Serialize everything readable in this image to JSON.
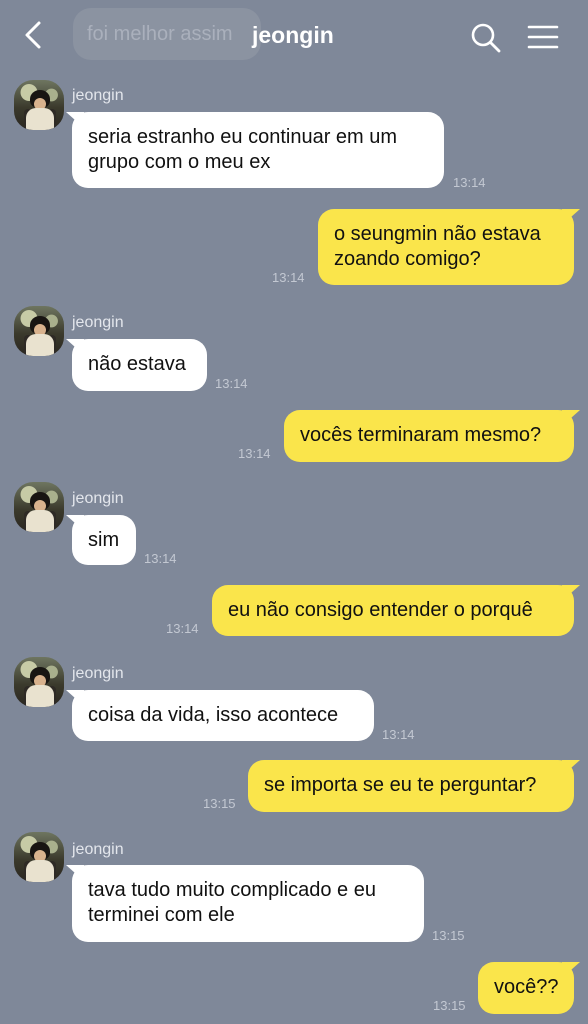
{
  "header": {
    "title": "jeongin",
    "ghost_preview": "foi melhor assim",
    "icons": [
      "back-icon",
      "search-icon",
      "menu-icon"
    ]
  },
  "colors": {
    "background": "#7f8899",
    "incoming_bubble": "#ffffff",
    "outgoing_bubble": "#fae54b"
  },
  "messages": [
    {
      "side": "in",
      "sender": "jeongin",
      "text": "seria estranho eu continuar em um grupo com o meu ex",
      "time": "13:14"
    },
    {
      "side": "out",
      "text": "o seungmin não estava zoando comigo?",
      "time": "13:14"
    },
    {
      "side": "in",
      "sender": "jeongin",
      "text": "não estava",
      "time": "13:14"
    },
    {
      "side": "out",
      "text": "vocês terminaram mesmo?",
      "time": "13:14"
    },
    {
      "side": "in",
      "sender": "jeongin",
      "text": "sim",
      "time": "13:14"
    },
    {
      "side": "out",
      "text": "eu não consigo entender o porquê",
      "time": "13:14"
    },
    {
      "side": "in",
      "sender": "jeongin",
      "text": "coisa da vida, isso acontece",
      "time": "13:14"
    },
    {
      "side": "out",
      "text": "se importa se eu te perguntar?",
      "time": "13:15"
    },
    {
      "side": "in",
      "sender": "jeongin",
      "text": "tava tudo muito complicado e eu terminei com ele",
      "time": "13:15"
    },
    {
      "side": "out",
      "text": "você??",
      "time": "13:15"
    }
  ]
}
